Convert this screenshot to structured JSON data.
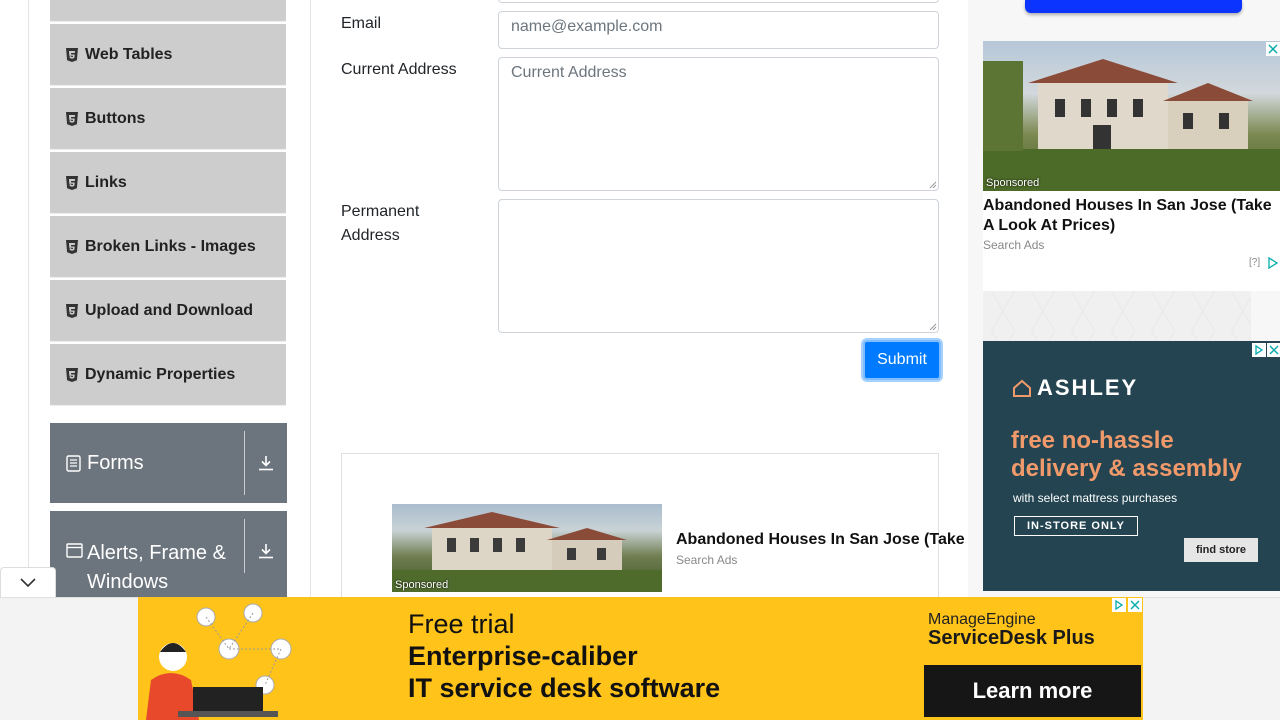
{
  "sidebar": {
    "items": [
      {
        "label": "Web Tables"
      },
      {
        "label": "Buttons"
      },
      {
        "label": "Links"
      },
      {
        "label": "Broken Links - Images"
      },
      {
        "label": "Upload and Download"
      },
      {
        "label": "Dynamic Properties"
      }
    ],
    "groups": [
      {
        "label": "Forms",
        "icon": "document-icon"
      },
      {
        "label": "Alerts, Frame &",
        "label2": "Windows",
        "icon": "window-icon"
      }
    ]
  },
  "form": {
    "email_label": "Email",
    "email_placeholder": "name@example.com",
    "current_address_label": "Current Address",
    "current_address_placeholder": "Current Address",
    "permanent_address_label_1": "Permanent",
    "permanent_address_label_2": "Address",
    "submit_label": "Submit"
  },
  "inline_ad": {
    "title": "Abandoned Houses In San Jose (Take",
    "source": "Search Ads",
    "sponsored": "Sponsored"
  },
  "side_ad": {
    "title": "Abandoned Houses In San Jose (Take A Look At Prices)",
    "source": "Search Ads",
    "sponsored": "Sponsored",
    "help": "[?]"
  },
  "ashley_ad": {
    "brand": "ASHLEY",
    "headline": "free no-hassle delivery & assembly",
    "subtext": "with select mattress purchases",
    "tag": "IN-STORE ONLY",
    "button": "find store"
  },
  "bottom_ad": {
    "line1": "Free trial",
    "line2": "Enterprise-caliber",
    "line3": "IT service desk software",
    "brand_1": "ManageEngine",
    "brand_2": "ServiceDesk Plus",
    "cta": "Learn more",
    "bg_color": "#ffc31a"
  },
  "colors": {
    "primary": "#007bff",
    "group_bg": "#6c757d",
    "menu_bg": "#cdcdcd"
  }
}
